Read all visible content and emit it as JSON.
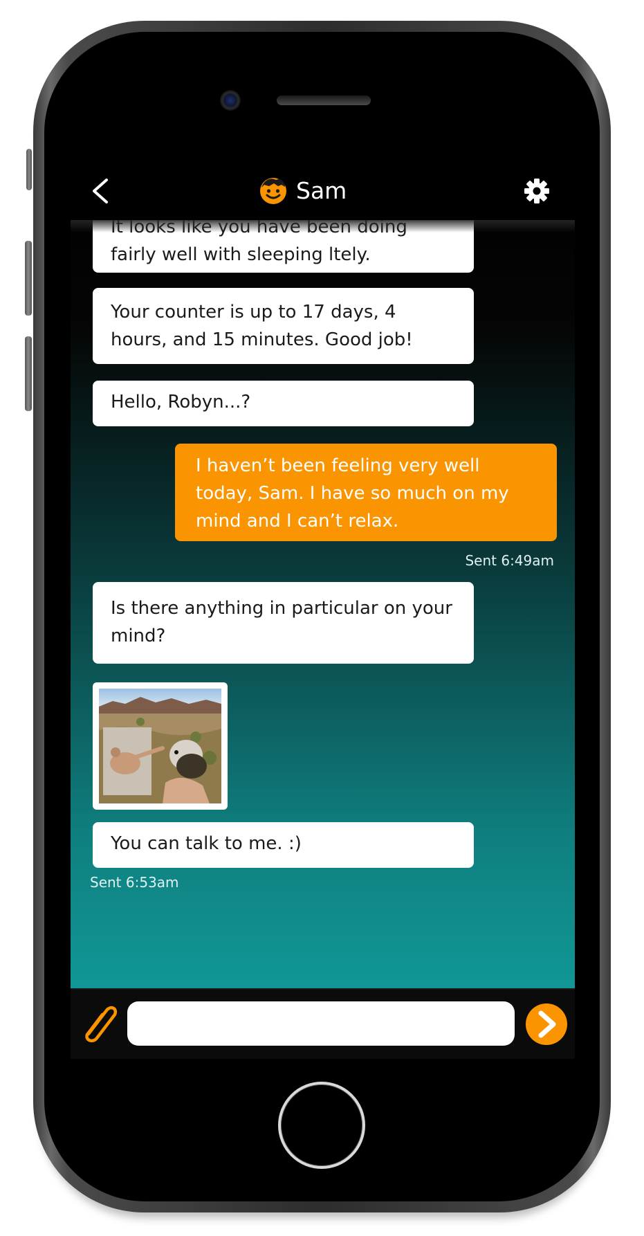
{
  "header": {
    "contact_name": "Sam",
    "back_icon": "chevron-left-icon",
    "settings_icon": "gear-icon",
    "avatar_icon": "smiley-avatar-icon"
  },
  "messages": [
    {
      "direction": "incoming",
      "text": "It looks like you have been doing fairly well with sleeping ltely."
    },
    {
      "direction": "incoming",
      "text": "Your counter is up to 17 days, 4 hours, and 15 minutes. Good job!"
    },
    {
      "direction": "incoming",
      "text": "Hello, Robyn...?"
    },
    {
      "direction": "outgoing",
      "text": "I haven’t been feeling very well today, Sam. I have so much on my mind and I can’t relax."
    },
    {
      "direction": "incoming",
      "text": "Is there anything in particular on your mind?"
    },
    {
      "direction": "incoming",
      "type": "image"
    },
    {
      "direction": "incoming",
      "text": "You can talk to me. :)"
    }
  ],
  "timestamps": {
    "outgoing_sent": "Sent 6:49am",
    "incoming_sent": "Sent 6:53am"
  },
  "composer": {
    "input_value": "",
    "attach_icon": "paperclip-icon",
    "send_icon": "chevron-right-icon"
  },
  "colors": {
    "accent": "#fb9401",
    "incoming_bubble": "#ffffff",
    "gradient_top": "#000000",
    "gradient_bottom": "#11a2a0"
  }
}
